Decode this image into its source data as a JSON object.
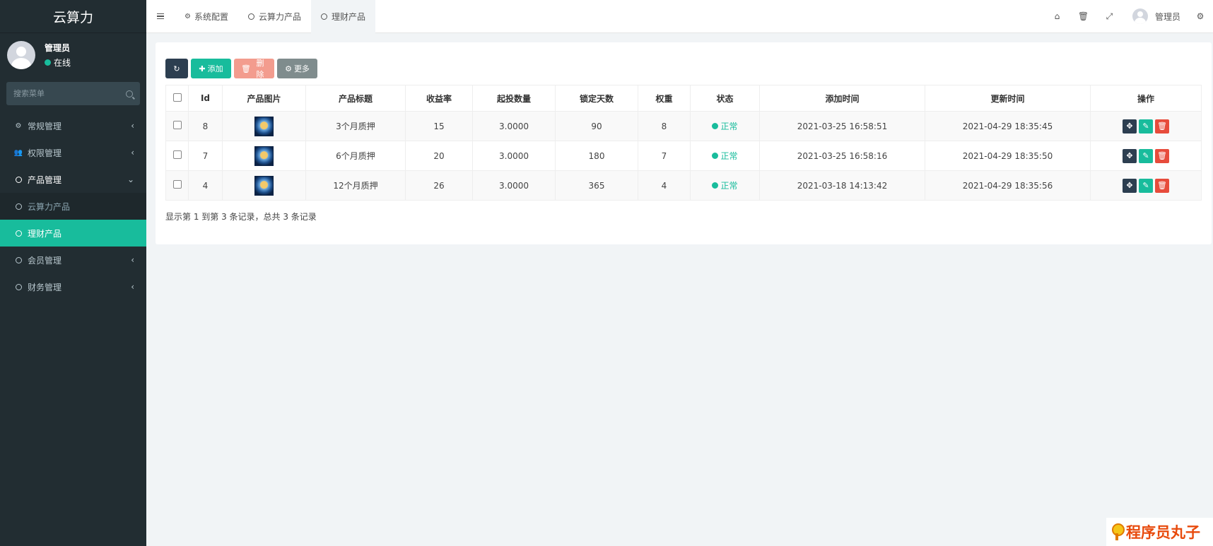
{
  "sidebar": {
    "brand": "云算力",
    "user": {
      "name": "管理员",
      "status": "在线"
    },
    "search": {
      "placeholder": "搜索菜单"
    },
    "menu": [
      {
        "label": "常规管理"
      },
      {
        "label": "权限管理"
      },
      {
        "label": "产品管理"
      },
      {
        "label": "云算力产品"
      },
      {
        "label": "理财产品"
      },
      {
        "label": "会员管理"
      },
      {
        "label": "财务管理"
      }
    ]
  },
  "topbar": {
    "tabs": [
      {
        "label": "系统配置"
      },
      {
        "label": "云算力产品"
      },
      {
        "label": "理财产品"
      }
    ],
    "user_name": "管理员"
  },
  "toolbar": {
    "add_label": "添加",
    "delete_label": "删除",
    "more_label": "更多"
  },
  "table": {
    "headers": [
      "Id",
      "产品图片",
      "产品标题",
      "收益率",
      "起投数量",
      "锁定天数",
      "权重",
      "状态",
      "添加时间",
      "更新时间",
      "操作"
    ],
    "rows": [
      {
        "id": "8",
        "title": "3个月质押",
        "rate": "15",
        "min": "3.0000",
        "days": "90",
        "weight": "8",
        "status": "正常",
        "created": "2021-03-25 16:58:51",
        "updated": "2021-04-29 18:35:45"
      },
      {
        "id": "7",
        "title": "6个月质押",
        "rate": "20",
        "min": "3.0000",
        "days": "180",
        "weight": "7",
        "status": "正常",
        "created": "2021-03-25 16:58:16",
        "updated": "2021-04-29 18:35:50"
      },
      {
        "id": "4",
        "title": "12个月质押",
        "rate": "26",
        "min": "3.0000",
        "days": "365",
        "weight": "4",
        "status": "正常",
        "created": "2021-03-18 14:13:42",
        "updated": "2021-04-29 18:35:56"
      }
    ]
  },
  "pager": {
    "text": "显示第 1 到第 3 条记录，总共 3 条记录"
  },
  "watermark": {
    "text": "程序员丸子"
  },
  "colors": {
    "accent": "#18bc9c",
    "sidebar_bg": "#222d32",
    "danger": "#e74c3c",
    "dark": "#2c3e50"
  }
}
